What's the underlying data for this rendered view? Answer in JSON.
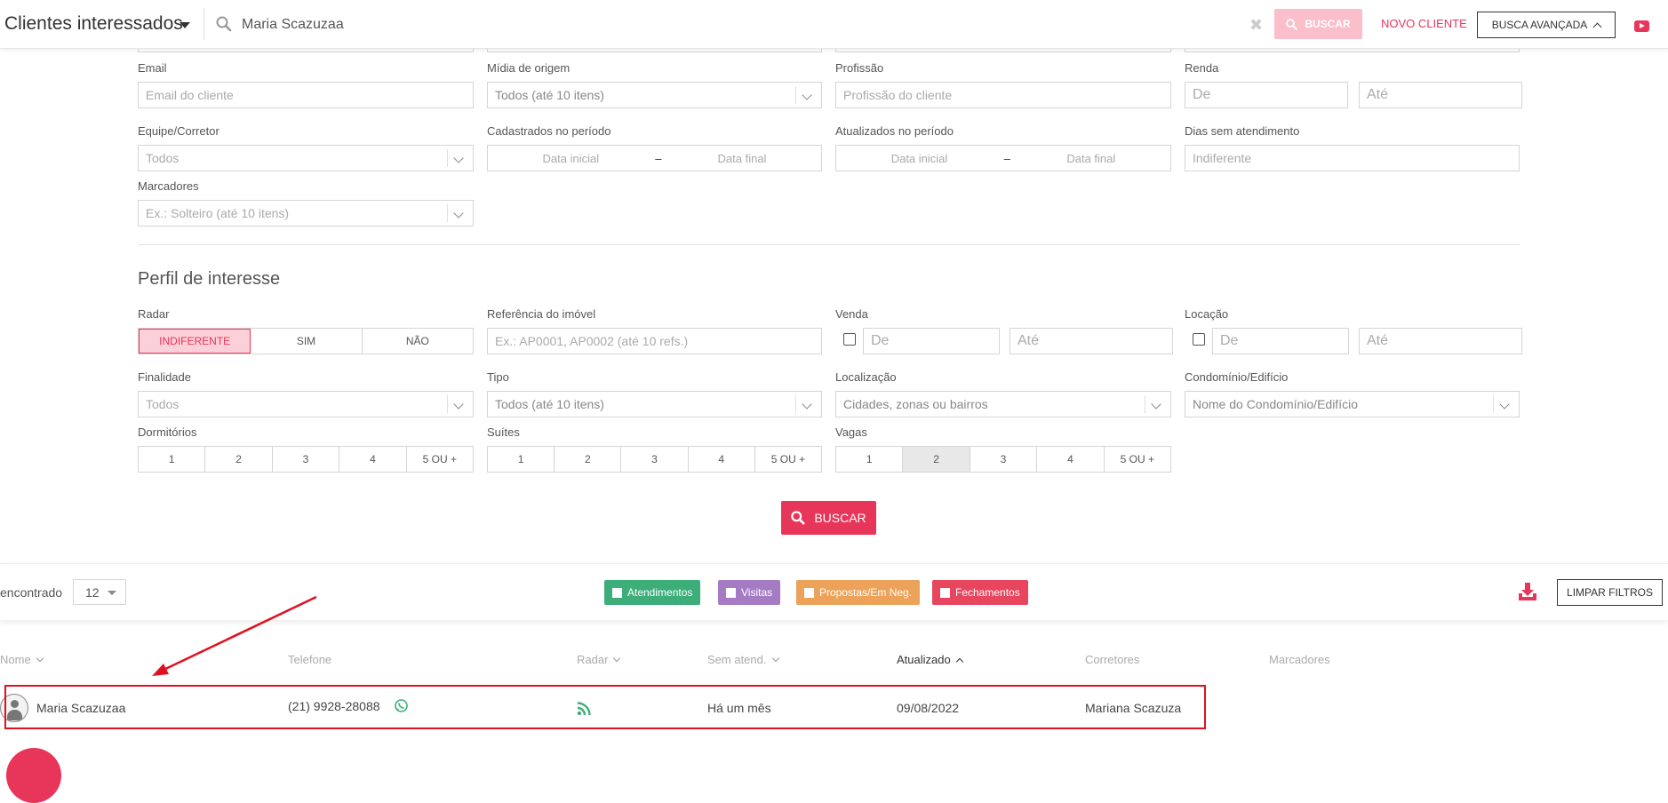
{
  "topbar": {
    "title": "Clientes interessados",
    "search_value": "Maria Scazuzaa",
    "clear": "✖",
    "buscar": "BUSCAR",
    "novo_cliente": "NOVO CLIENTE",
    "busca_avancada": "BUSCA AVANÇADA"
  },
  "filters": {
    "email": {
      "label": "Email",
      "placeholder": "Email do cliente"
    },
    "midia": {
      "label": "Mídia de origem",
      "value": "Todos (até 10 itens)"
    },
    "profissao": {
      "label": "Profissão",
      "placeholder": "Profissão do cliente"
    },
    "renda": {
      "label": "Renda",
      "de": "De",
      "ate": "Até"
    },
    "equipe": {
      "label": "Equipe/Corretor",
      "value": "Todos"
    },
    "cadastrados": {
      "label": "Cadastrados no período",
      "inicial": "Data inicial",
      "final": "Data final",
      "dash": "–"
    },
    "atualizados": {
      "label": "Atualizados no período",
      "inicial": "Data inicial",
      "final": "Data final",
      "dash": "–"
    },
    "dias": {
      "label": "Dias sem atendimento",
      "placeholder": "Indiferente"
    },
    "marcadores": {
      "label": "Marcadores",
      "value": "Ex.: Solteiro (até 10 itens)"
    }
  },
  "perfil": {
    "title": "Perfil de interesse",
    "radar": {
      "label": "Radar",
      "options": [
        "INDIFERENTE",
        "SIM",
        "NÃO"
      ],
      "selected": "INDIFERENTE"
    },
    "referencia": {
      "label": "Referência do imóvel",
      "placeholder": "Ex.: AP0001, AP0002 (até 10 refs.)"
    },
    "venda": {
      "label": "Venda",
      "de": "De",
      "ate": "Até"
    },
    "locacao": {
      "label": "Locação",
      "de": "De",
      "ate": "Até"
    },
    "finalidade": {
      "label": "Finalidade",
      "value": "Todos"
    },
    "tipo": {
      "label": "Tipo",
      "value": "Todos (até 10 itens)"
    },
    "localizacao": {
      "label": "Localização",
      "value": "Cidades, zonas ou bairros"
    },
    "condominio": {
      "label": "Condomínio/Edifício",
      "value": "Nome do Condomínio/Edifício"
    },
    "dormitorios": {
      "label": "Dormitórios",
      "options": [
        "1",
        "2",
        "3",
        "4",
        "5 OU +"
      ]
    },
    "suites": {
      "label": "Suítes",
      "options": [
        "1",
        "2",
        "3",
        "4",
        "5 OU +"
      ]
    },
    "vagas": {
      "label": "Vagas",
      "options": [
        "1",
        "2",
        "3",
        "4",
        "5 OU +"
      ],
      "selected": "2"
    },
    "buscar": "BUSCAR"
  },
  "results": {
    "encontrado": "encontrado",
    "per_page": "12",
    "tags": [
      {
        "label": "Atendimentos",
        "color": "#3dae7a"
      },
      {
        "label": "Visitas",
        "color": "#a57cc4"
      },
      {
        "label": "Propostas/Em Neg.",
        "color": "#eda25a"
      },
      {
        "label": "Fechamentos",
        "color": "#e8455e"
      }
    ],
    "limpar": "LIMPAR FILTROS"
  },
  "table": {
    "headers": {
      "nome": "Nome",
      "telefone": "Telefone",
      "radar": "Radar",
      "sem_atend": "Sem atend.",
      "atualizado": "Atualizado",
      "corretores": "Corretores",
      "marcadores": "Marcadores"
    },
    "rows": [
      {
        "nome": "Maria Scazuzaa",
        "telefone": "(21) 9928-28088",
        "sem_atend": "Há um mês",
        "atualizado": "09/08/2022",
        "corretores": "Mariana Scazuza"
      }
    ]
  },
  "colors": {
    "accent": "#e8355a",
    "annotation": "#e01020"
  }
}
